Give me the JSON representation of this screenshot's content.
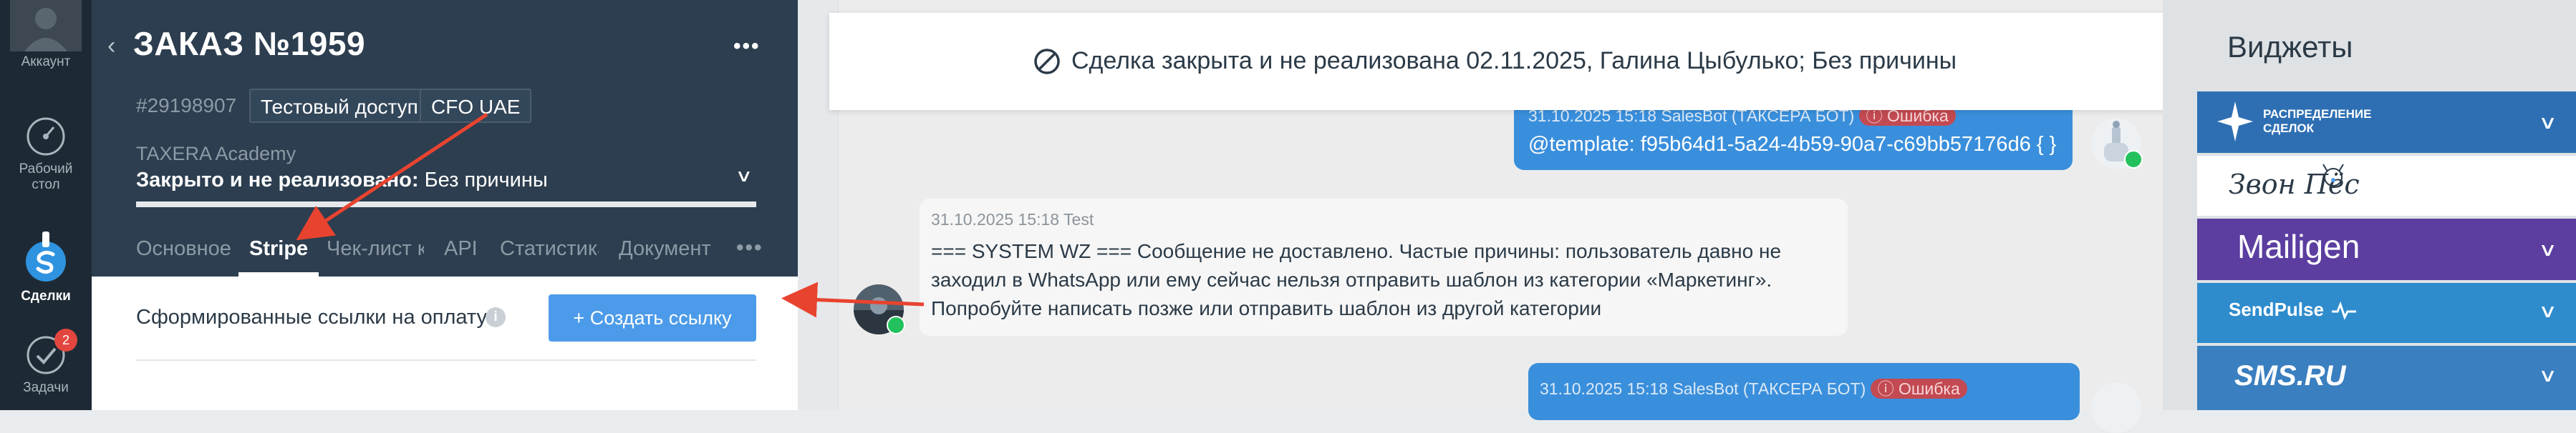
{
  "nav": {
    "account_label": "Аккаунт",
    "dashboard_label": "Рабочий стол",
    "deals_label": "Сделки",
    "tasks_label": "Задачи",
    "tasks_badge": "2"
  },
  "deal": {
    "back_icon": "chevron-left-icon",
    "title": "ЗАКАЗ №1959",
    "more": "•••",
    "id": "#29198907",
    "tags": [
      "Тестовый доступ",
      "CFO UAE"
    ],
    "pipeline": "TAXERA Academy",
    "status_bold": "Закрыто и не реализовано:",
    "status_reason": " Без причины",
    "tabs": [
      "Основное",
      "Stripe",
      "Чек-лист к",
      "API",
      "Статистика",
      "Документ"
    ],
    "active_tab": "Stripe",
    "tabs_more": "•••",
    "payment_links_label": "Сформированные ссылки на оплату",
    "info_icon": "i",
    "create_link_label": "+  Создать ссылку"
  },
  "feed": {
    "closed_banner": "Сделка закрыта и не реализована 02.11.2025, Галина Цыбулько; Без причины",
    "messages": [
      {
        "meta": "31.10.2025 15:18 SalesBot (ТАКСЕРА БОТ)",
        "error": "ⓘ Ошибка",
        "text": "@template: f95b64d1-5a24-4b59-90a7-c69bb57176d6 { }"
      },
      {
        "meta": "31.10.2025 15:18 Test",
        "lines": [
          "=== SYSTEM WZ === Сообщение не доставлено. Частые причины: пользователь давно не",
          "заходил в WhatsApp или ему сейчас нельзя отправить шаблон из категории «Маркетинг».",
          "Попробуйте написать позже или отправить шаблон из другой категории"
        ]
      },
      {
        "meta": "31.10.2025 15:18 SalesBot (ТАКСЕРА БОТ)",
        "error": "ⓘ Ошибка"
      }
    ]
  },
  "widgets": {
    "title": "Виджеты",
    "items": [
      {
        "name": "РАСПРЕДЕЛЕНИЕ СДЕЛОК",
        "color": "#2e6fb3"
      },
      {
        "name": "Звон  Пёс",
        "color": "#ffffff"
      },
      {
        "name": "Mailigen",
        "color": "#5b3ea0"
      },
      {
        "name": "SendPulse",
        "color": "#2e8ccd"
      },
      {
        "name": "SMS.RU",
        "color": "#3a7fbf"
      }
    ]
  },
  "colors": {
    "accent": "#4c9bea",
    "error": "#c34a52",
    "panel": "#2c3e4f",
    "annotation_arrow": "#e8432f"
  }
}
